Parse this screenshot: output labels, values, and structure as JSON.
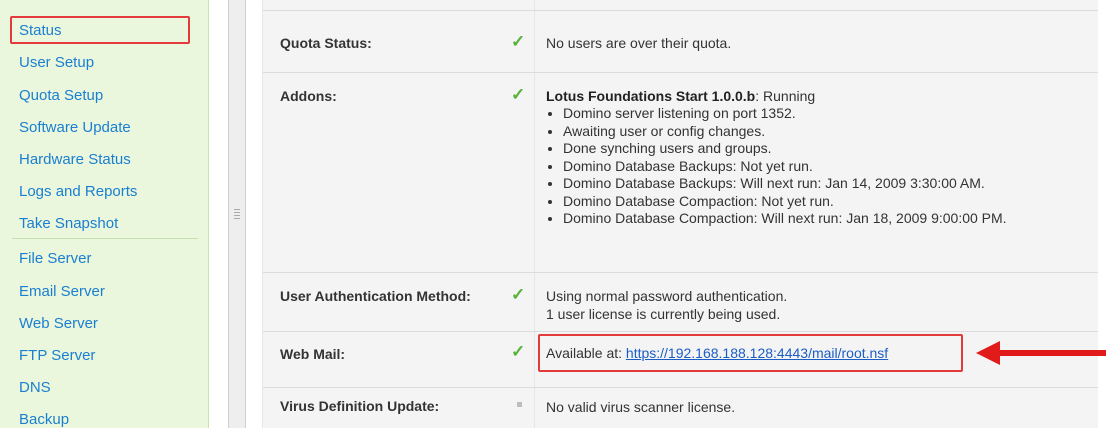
{
  "sidebar": {
    "items": [
      {
        "label": "Status"
      },
      {
        "label": "User Setup"
      },
      {
        "label": "Quota Setup"
      },
      {
        "label": "Software Update"
      },
      {
        "label": "Hardware Status"
      },
      {
        "label": "Logs and Reports"
      },
      {
        "label": "Take Snapshot"
      },
      {
        "label": "File Server"
      },
      {
        "label": "Email Server"
      },
      {
        "label": "Web Server"
      },
      {
        "label": "FTP Server"
      },
      {
        "label": "DNS"
      },
      {
        "label": "Backup"
      }
    ],
    "selected_index": 0
  },
  "status_table": {
    "rows": [
      {
        "label": "Quota Status:",
        "status_icon": "check-icon",
        "text": "No users are over their quota."
      },
      {
        "label": "Addons:",
        "status_icon": "check-icon",
        "addon_name": "Lotus Foundations Start 1.0.0.b",
        "addon_state": ": Running",
        "bullets": [
          "Domino server listening on port 1352.",
          "Awaiting user or config changes.",
          "Done synching users and groups.",
          "Domino Database Backups: Not yet run.",
          "Domino Database Backups: Will next run: Jan 14, 2009 3:30:00 AM.",
          "Domino Database Compaction: Not yet run.",
          "Domino Database Compaction: Will next run: Jan 18, 2009 9:00:00 PM."
        ]
      },
      {
        "label": "User Authentication Method:",
        "status_icon": "check-icon",
        "lines": [
          "Using normal password authentication.",
          "1 user license is currently being used."
        ]
      },
      {
        "label": "Web Mail:",
        "status_icon": "check-icon",
        "prefix": "Available at: ",
        "link": "https://192.168.188.128:4443/mail/root.nsf"
      },
      {
        "label": "Virus Definition Update:",
        "status_icon": "neutral-icon",
        "text": "No valid virus scanner license."
      }
    ]
  },
  "annotation": {
    "highlight_color": "#e33b3b",
    "arrow_color": "#e11a1a"
  },
  "colors": {
    "sidebar_bg": "#eaf7dc",
    "link": "#1a7fd1",
    "check": "#56b33a"
  }
}
